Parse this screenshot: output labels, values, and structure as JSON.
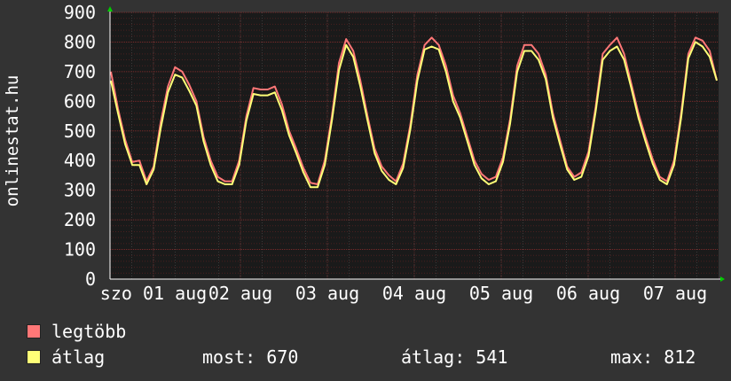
{
  "chart_data": {
    "type": "line",
    "ylabel": "onlinestat.hu",
    "ylim": [
      0,
      900
    ],
    "yticks": [
      "0",
      "100",
      "200",
      "300",
      "400",
      "500",
      "600",
      "700",
      "800",
      "900"
    ],
    "xticks": [
      "szo 01 aug",
      "h 02 aug",
      "k 03 aug",
      "sze 04 aug",
      "cs 05 aug",
      "p 06 aug",
      "szo 07 aug"
    ],
    "xticks_display": [
      "szo 01 aug",
      "02 aug",
      "03 aug",
      "04 aug",
      "05 aug",
      "06 aug",
      "07 aug"
    ],
    "grid": true,
    "series": [
      {
        "name": "legtöbb",
        "color": "#ff7777",
        "values": [
          700,
          575,
          470,
          395,
          400,
          330,
          380,
          530,
          650,
          715,
          700,
          655,
          600,
          480,
          400,
          345,
          330,
          330,
          400,
          550,
          645,
          640,
          640,
          650,
          590,
          500,
          440,
          375,
          325,
          320,
          400,
          550,
          730,
          810,
          770,
          670,
          550,
          440,
          380,
          350,
          330,
          390,
          520,
          690,
          790,
          815,
          790,
          720,
          620,
          560,
          480,
          400,
          355,
          335,
          345,
          410,
          540,
          720,
          790,
          790,
          760,
          690,
          560,
          470,
          380,
          345,
          360,
          430,
          580,
          760,
          790,
          815,
          760,
          660,
          560,
          480,
          405,
          345,
          330,
          400,
          560,
          760,
          815,
          805,
          770,
          670
        ]
      },
      {
        "name": "átlag",
        "color": "#ffff77",
        "values": [
          670,
          560,
          455,
          385,
          385,
          320,
          370,
          510,
          630,
          690,
          680,
          635,
          585,
          465,
          385,
          330,
          320,
          320,
          385,
          535,
          625,
          620,
          620,
          630,
          570,
          485,
          425,
          360,
          310,
          310,
          385,
          535,
          705,
          790,
          750,
          650,
          535,
          425,
          365,
          335,
          320,
          375,
          505,
          670,
          775,
          785,
          775,
          700,
          600,
          545,
          465,
          385,
          340,
          320,
          330,
          395,
          525,
          700,
          770,
          770,
          740,
          675,
          545,
          455,
          370,
          335,
          345,
          415,
          565,
          740,
          770,
          785,
          740,
          645,
          545,
          465,
          390,
          335,
          320,
          385,
          545,
          745,
          800,
          785,
          750,
          670
        ]
      }
    ]
  },
  "legend": {
    "max_label": "legtöbb",
    "avg_label": "átlag",
    "now": "most: 670",
    "average": "átlag: 541",
    "maximum": "max: 812"
  }
}
